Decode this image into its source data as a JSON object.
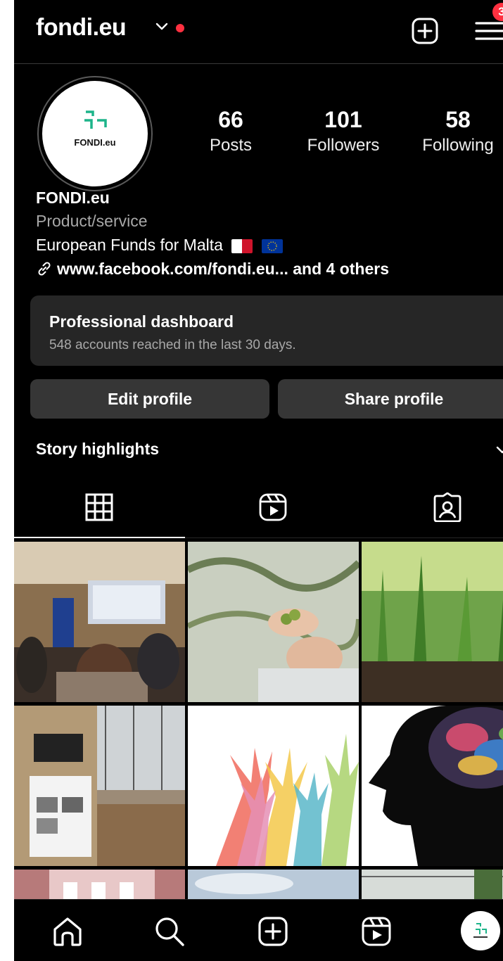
{
  "header": {
    "username": "fondi.eu",
    "notification_badge": "3",
    "icons": [
      "chevron-down-icon",
      "new-post-icon",
      "menu-icon"
    ]
  },
  "profile": {
    "avatar_text": "FONDI.eu",
    "stats": [
      {
        "value": "66",
        "label": "Posts"
      },
      {
        "value": "101",
        "label": "Followers"
      },
      {
        "value": "58",
        "label": "Following"
      }
    ],
    "name": "FONDI.eu",
    "category": "Product/service",
    "bio": "European Funds for Malta",
    "link": "www.facebook.com/fondi.eu... and 4 others"
  },
  "dashboard": {
    "title": "Professional dashboard",
    "subtitle": "548 accounts reached in the last 30 days."
  },
  "buttons": {
    "edit": "Edit profile",
    "share": "Share profile"
  },
  "story_highlights": {
    "label": "Story highlights"
  },
  "tabs": [
    "grid-icon",
    "reels-icon",
    "tagged-icon"
  ],
  "posts": [
    {
      "name": "post-conference-room"
    },
    {
      "name": "post-olive-harvest"
    },
    {
      "name": "post-young-crops"
    },
    {
      "name": "post-greenhouse-plaque"
    },
    {
      "name": "post-colorful-hands"
    },
    {
      "name": "post-head-silhouette"
    },
    {
      "name": "post-mind"
    },
    {
      "name": "post-sky"
    },
    {
      "name": "post-greenhouse-2"
    }
  ],
  "bottom_nav": [
    "home-icon",
    "search-icon",
    "create-icon",
    "reels-icon",
    "profile-avatar"
  ],
  "colors": {
    "background": "#000000",
    "button": "#363636",
    "card": "#262626",
    "secondary_text": "#a8a8a8",
    "accent_red": "#ff3040"
  }
}
